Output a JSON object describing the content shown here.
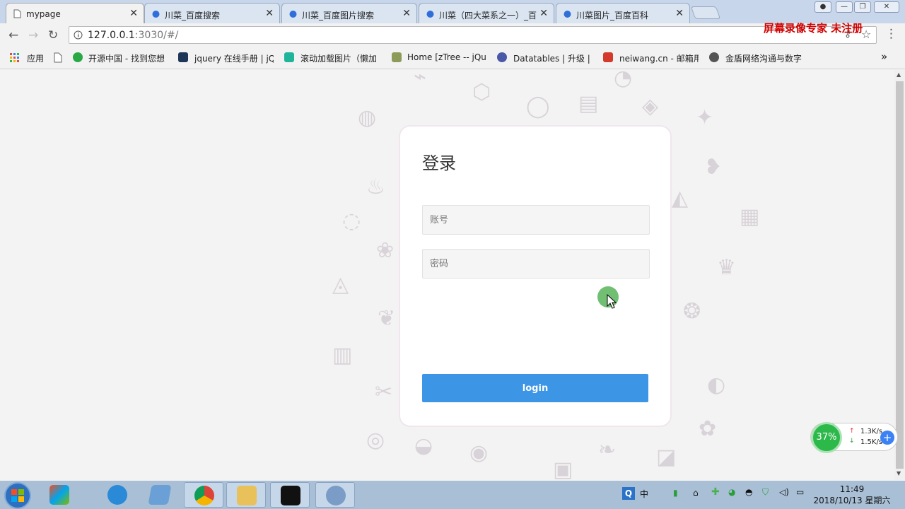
{
  "browser": {
    "tabs": [
      {
        "label": "mypage",
        "active": true
      },
      {
        "label": "川菜_百度搜索",
        "active": false
      },
      {
        "label": "川菜_百度图片搜索",
        "active": false
      },
      {
        "label": "川菜（四大菜系之一）_百",
        "active": false
      },
      {
        "label": "川菜图片_百度百科",
        "active": false
      }
    ],
    "url_host": "127.0.0.1",
    "url_rest": ":3030/#/",
    "watermark": "屏幕录像专家 未注册",
    "bookmarks": [
      {
        "label": "应用"
      },
      {
        "label": ""
      },
      {
        "label": "开源中国 - 找到您想"
      },
      {
        "label": "jquery 在线手册 | jQ"
      },
      {
        "label": "滚动加载图片（懒加"
      },
      {
        "label": "Home [zTree -- jQu"
      },
      {
        "label": "Datatables | 升级 | 1"
      },
      {
        "label": "neiwang.cn - 邮箱用"
      },
      {
        "label": "金盾网络沟通与数字"
      }
    ],
    "bookmarks_more": "»"
  },
  "login": {
    "title": "登录",
    "account_placeholder": "账号",
    "password_placeholder": "密码",
    "button_label": "login"
  },
  "netmon": {
    "percent": "37%",
    "up": "1.3K/s",
    "down": "1.5K/s"
  },
  "taskbar": {
    "time": "11:49",
    "date": "2018/10/13 星期六",
    "ime": "中"
  },
  "colors": {
    "button": "#3d95e6",
    "watermark": "#d10000",
    "netmon_green": "#2db84a"
  }
}
